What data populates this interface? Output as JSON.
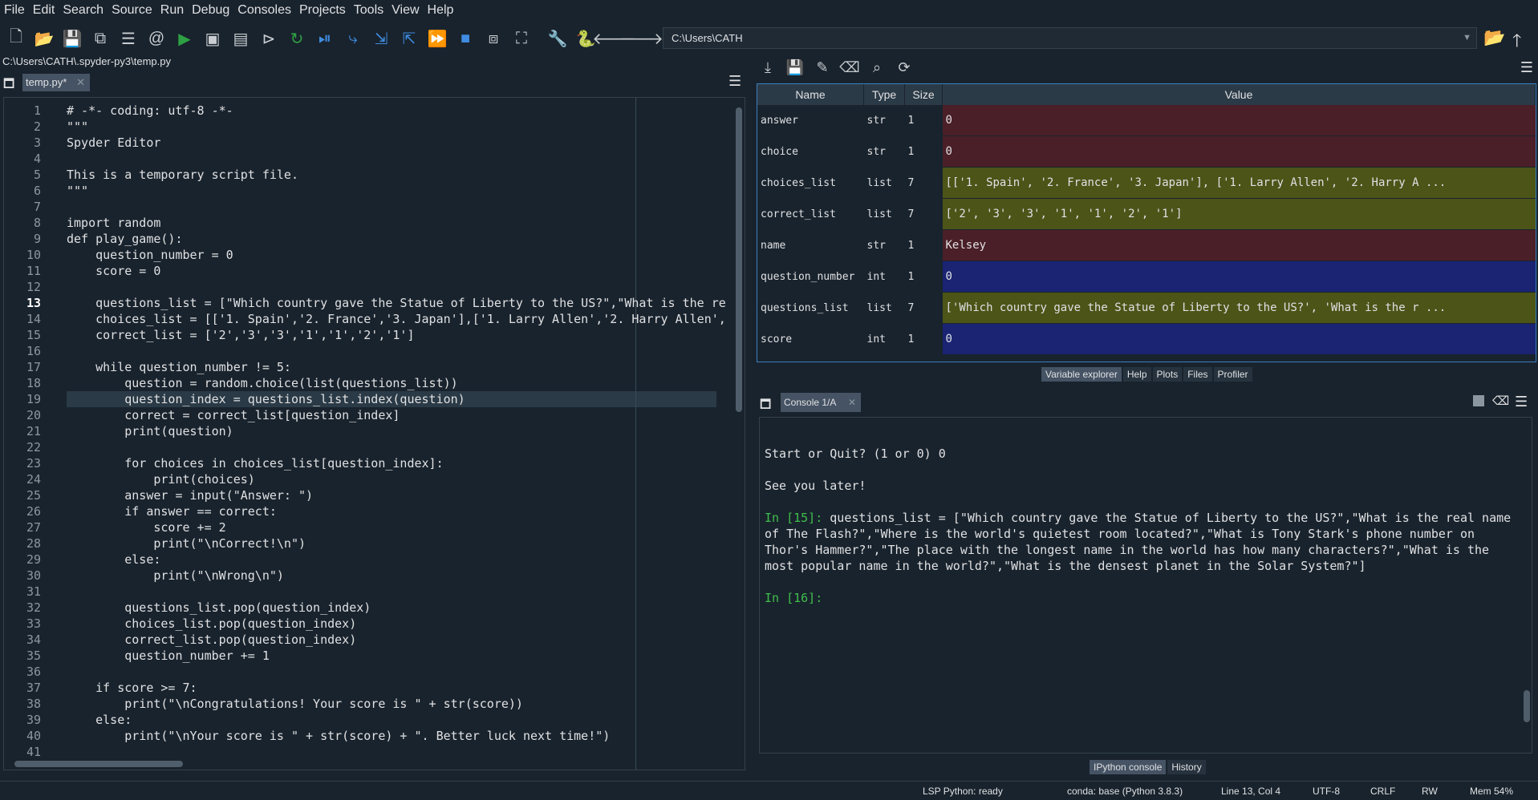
{
  "menu": [
    "File",
    "Edit",
    "Search",
    "Source",
    "Run",
    "Debug",
    "Consoles",
    "Projects",
    "Tools",
    "View",
    "Help"
  ],
  "path_box": "C:\\Users\\CATH",
  "file_path": "C:\\Users\\CATH\\.spyder-py3\\temp.py",
  "editor_tab": "temp.py*",
  "code_lines": [
    "# -*- coding: utf-8 -*-",
    "\"\"\"",
    "Spyder Editor",
    "",
    "This is a temporary script file.",
    "\"\"\"",
    "",
    "import random",
    "def play_game():",
    "    question_number = 0",
    "    score = 0",
    "",
    "    questions_list = [\"Which country gave the Statue of Liberty to the US?\",\"What is the re",
    "    choices_list = [['1. Spain','2. France','3. Japan'],['1. Larry Allen','2. Harry Allen',",
    "    correct_list = ['2','3','3','1','1','2','1']",
    "",
    "    while question_number != 5:",
    "        question = random.choice(list(questions_list))",
    "        question_index = questions_list.index(question)",
    "        correct = correct_list[question_index]",
    "        print(question)",
    "",
    "        for choices in choices_list[question_index]:",
    "            print(choices)",
    "        answer = input(\"Answer: \")",
    "        if answer == correct:",
    "            score += 2",
    "            print(\"\\nCorrect!\\n\")",
    "        else:",
    "            print(\"\\nWrong\\n\")",
    "",
    "        questions_list.pop(question_index)",
    "        choices_list.pop(question_index)",
    "        correct_list.pop(question_index)",
    "        question_number += 1",
    "",
    "    if score >= 7:",
    "        print(\"\\nCongratulations! Your score is \" + str(score))",
    "    else:",
    "        print(\"\\nYour score is \" + str(score) + \". Better luck next time!\")",
    ""
  ],
  "current_line": 13,
  "variable_explorer": {
    "headers": [
      "Name",
      "Type",
      "Size",
      "Value"
    ],
    "rows": [
      {
        "name": "answer",
        "type": "str",
        "size": "1",
        "value": "0",
        "color": "#4a1f28"
      },
      {
        "name": "choice",
        "type": "str",
        "size": "1",
        "value": "0",
        "color": "#4a1f28"
      },
      {
        "name": "choices_list",
        "type": "list",
        "size": "7",
        "value": "[['1. Spain', '2. France', '3. Japan'], ['1. Larry Allen', '2. Harry A ...",
        "color": "#4c5418"
      },
      {
        "name": "correct_list",
        "type": "list",
        "size": "7",
        "value": "['2', '3', '3', '1', '1', '2', '1']",
        "color": "#4c5418"
      },
      {
        "name": "name",
        "type": "str",
        "size": "1",
        "value": " Kelsey",
        "color": "#4a1f28"
      },
      {
        "name": "question_number",
        "type": "int",
        "size": "1",
        "value": "0",
        "color": "#1a2473"
      },
      {
        "name": "questions_list",
        "type": "list",
        "size": "7",
        "value": "['Which country gave the Statue of Liberty to the US?', 'What is the r ...",
        "color": "#4c5418"
      },
      {
        "name": "score",
        "type": "int",
        "size": "1",
        "value": "0",
        "color": "#1a2473"
      }
    ]
  },
  "upper_tabs": [
    "Variable explorer",
    "Help",
    "Plots",
    "Files",
    "Profiler"
  ],
  "console_tab": "Console 1/A",
  "console": {
    "line1": "Start or Quit? (1 or 0) 0",
    "line2": "See you later!",
    "prompt15": "In [15]:",
    "cmd15a": " questions_list = [\"Which country gave the Statue of Liberty to the US?\",\"What is the real name",
    "cmd15b": "of The Flash?\",\"Where is the world's quietest room located?\",\"What is Tony Stark's phone number on",
    "cmd15c": "Thor's Hammer?\",\"The place with the longest name in the world has how many characters?\",\"What is the",
    "cmd15d": "most popular name in the world?\",\"What is the densest planet in the Solar System?\"]",
    "prompt16": "In [16]:"
  },
  "lower_tabs": [
    "IPython console",
    "History"
  ],
  "status": {
    "lsp": "LSP Python: ready",
    "conda": "conda: base (Python 3.8.3)",
    "pos": "Line 13, Col 4",
    "enc": "UTF-8",
    "eol": "CRLF",
    "rw": "RW",
    "mem": "Mem 54%"
  }
}
